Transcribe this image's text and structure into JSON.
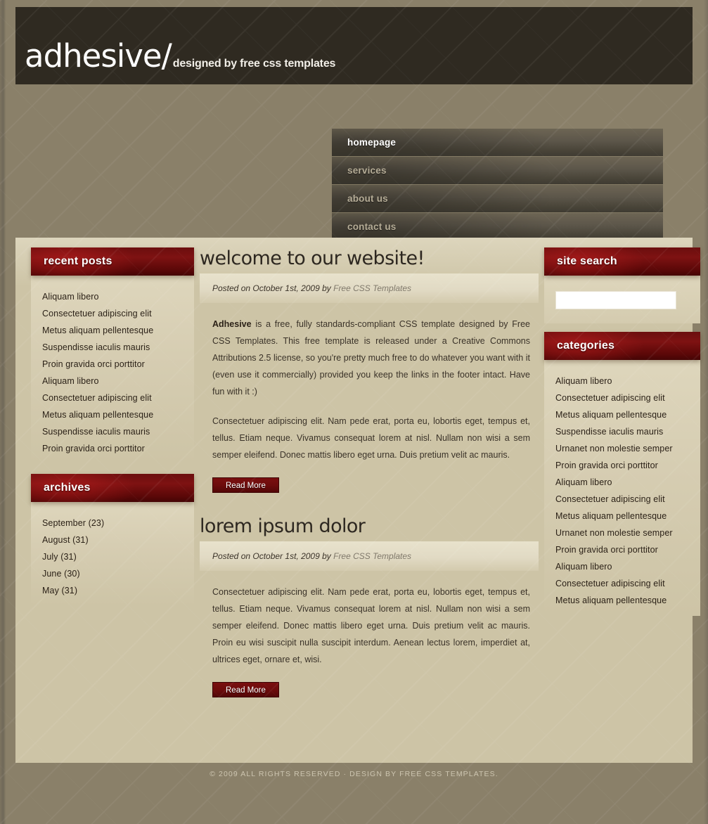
{
  "site": {
    "brand": "adhesive/",
    "tagline": "designed by free css templates"
  },
  "nav": {
    "items": [
      {
        "label": "homepage",
        "active": true
      },
      {
        "label": "services",
        "active": false
      },
      {
        "label": "about us",
        "active": false
      },
      {
        "label": "contact us",
        "active": false
      }
    ]
  },
  "sidebar_left": {
    "recent_posts": {
      "title": "recent posts",
      "items": [
        "Aliquam libero",
        "Consectetuer adipiscing elit",
        "Metus aliquam pellentesque",
        "Suspendisse iaculis mauris",
        "Proin gravida orci porttitor",
        "Aliquam libero",
        "Consectetuer adipiscing elit",
        "Metus aliquam pellentesque",
        "Suspendisse iaculis mauris",
        "Proin gravida orci porttitor"
      ]
    },
    "archives": {
      "title": "archives",
      "items": [
        "September (23)",
        "August (31)",
        "July (31)",
        "June (30)",
        "May (31)"
      ]
    }
  },
  "main": {
    "posts": [
      {
        "title": "welcome to our website!",
        "meta_prefix": "Posted on October 1st, 2009 by ",
        "meta_author": "Free CSS Templates",
        "lead_strong": "Adhesive",
        "lead_rest": " is a free, fully standards-compliant CSS template designed by Free CSS Templates. This free template is released under a Creative Commons Attributions 2.5 license, so you're pretty much free to do whatever you want with it (even use it commercially) provided you keep the links in the footer intact. Have fun with it :)",
        "body": "Consectetuer adipiscing elit. Nam pede erat, porta eu, lobortis eget, tempus et, tellus. Etiam neque. Vivamus consequat lorem at nisl. Nullam non wisi a sem semper eleifend. Donec mattis libero eget urna. Duis pretium velit ac mauris.",
        "read_more": "Read More"
      },
      {
        "title": "lorem ipsum dolor",
        "meta_prefix": "Posted on October 1st, 2009 by ",
        "meta_author": "Free CSS Templates",
        "body": "Consectetuer adipiscing elit. Nam pede erat, porta eu, lobortis eget, tempus et, tellus. Etiam neque. Vivamus consequat lorem at nisl. Nullam non wisi a sem semper eleifend. Donec mattis libero eget urna. Duis pretium velit ac mauris. Proin eu wisi suscipit nulla suscipit interdum. Aenean lectus lorem, imperdiet at, ultrices eget, ornare et, wisi.",
        "read_more": "Read More"
      }
    ]
  },
  "sidebar_right": {
    "search": {
      "title": "site search",
      "value": "",
      "placeholder": ""
    },
    "categories": {
      "title": "categories",
      "items": [
        "Aliquam libero",
        "Consectetuer adipiscing elit",
        "Metus aliquam pellentesque",
        "Suspendisse iaculis mauris",
        "Urnanet non molestie semper",
        "Proin gravida orci porttitor",
        "Aliquam libero",
        "Consectetuer adipiscing elit",
        "Metus aliquam pellentesque",
        "Urnanet non molestie semper",
        "Proin gravida orci porttitor",
        "Aliquam libero",
        "Consectetuer adipiscing elit",
        "Metus aliquam pellentesque"
      ]
    }
  },
  "footer": {
    "text": "© 2009 ALL RIGHTS RESERVED  ·  DESIGN BY FREE CSS TEMPLATES."
  },
  "colors": {
    "page_bg": "#8a8069",
    "header_bg": "#2f2a21",
    "panel_bg": "#cdc4a6",
    "accent_red": "#6b0e0e",
    "nav_bg": "#5c564a"
  }
}
